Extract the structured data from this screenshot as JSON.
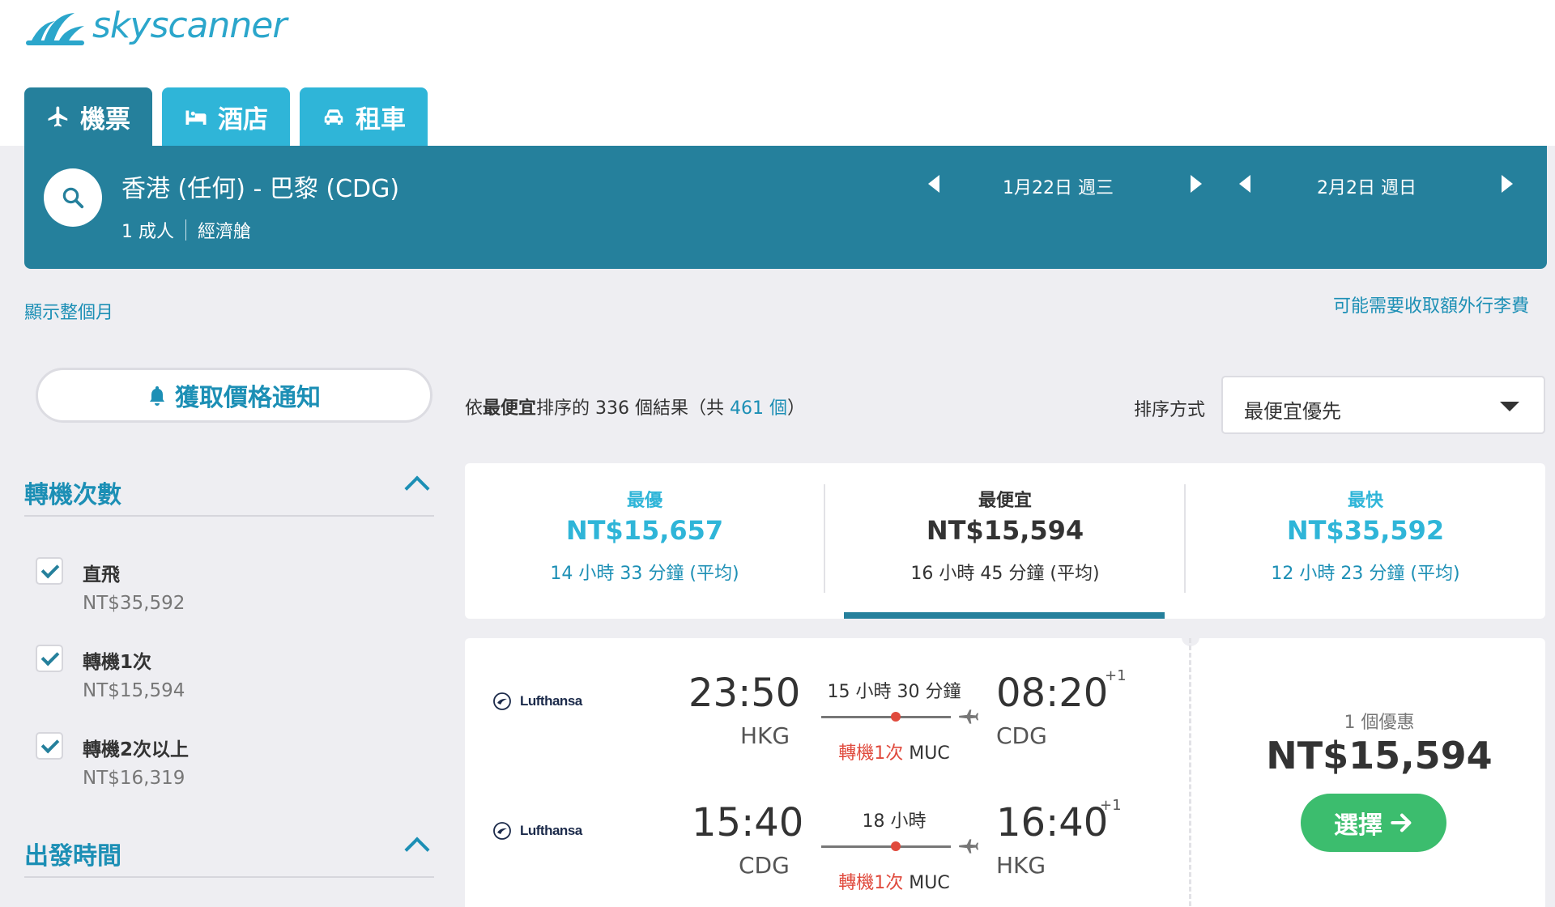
{
  "brand": {
    "name": "skyscanner",
    "color": "#2ba6cb"
  },
  "nav_tabs": [
    {
      "label": "機票",
      "icon": "plane-icon",
      "active": true
    },
    {
      "label": "酒店",
      "icon": "bed-icon",
      "active": false
    },
    {
      "label": "租車",
      "icon": "car-icon",
      "active": false
    }
  ],
  "search": {
    "route": "香港 (任何) - 巴黎 (CDG)",
    "passengers": "1 成人",
    "cabin": "經濟艙",
    "depart_date": "1月22日 週三",
    "return_date": "2月2日 週日"
  },
  "links": {
    "show_month": "顯示整個月",
    "baggage_fees": "可能需要收取額外行李費"
  },
  "price_alert": {
    "label": "獲取價格通知"
  },
  "filters": {
    "stops_title": "轉機次數",
    "departure_title": "出發時間",
    "stops": [
      {
        "label": "直飛",
        "price": "NT$35,592",
        "checked": true
      },
      {
        "label": "轉機1次",
        "price": "NT$15,594",
        "checked": true
      },
      {
        "label": "轉機2次以上",
        "price": "NT$16,319",
        "checked": true
      }
    ]
  },
  "results": {
    "prefix": "依",
    "sort_bold": "最便宜",
    "middle": "排序的 336 個結果（共 ",
    "total": "461 個",
    "suffix": "）"
  },
  "sort": {
    "label": "排序方式",
    "value": "最便宜優先"
  },
  "best_options": [
    {
      "title": "最優",
      "price": "NT$15,657",
      "duration": "14 小時 33 分鐘 (平均)"
    },
    {
      "title": "最便宜",
      "price": "NT$15,594",
      "duration": "16 小時 45 分鐘 (平均)",
      "selected": true
    },
    {
      "title": "最快",
      "price": "NT$35,592",
      "duration": "12 小時 23 分鐘 (平均)"
    }
  ],
  "flight": {
    "legs": [
      {
        "airline": "Lufthansa",
        "depart_time": "23:50",
        "depart_code": "HKG",
        "duration": "15 小時 30 分鐘",
        "stops": "轉機1次",
        "via": "MUC",
        "arrive_time": "08:20",
        "arrive_code": "CDG",
        "day_offset": "+1"
      },
      {
        "airline": "Lufthansa",
        "depart_time": "15:40",
        "depart_code": "CDG",
        "duration": "18 小時",
        "stops": "轉機1次",
        "via": "MUC",
        "arrive_time": "16:40",
        "arrive_code": "HKG",
        "day_offset": "+1"
      }
    ],
    "offers": "1 個優惠",
    "price": "NT$15,594",
    "select_label": "選擇"
  },
  "colors": {
    "dark_teal": "#25809c",
    "light_teal": "#2fb5d8",
    "link_blue": "#1c8fb5",
    "stop_red": "#e04a3d",
    "select_green": "#3cbd6e"
  }
}
